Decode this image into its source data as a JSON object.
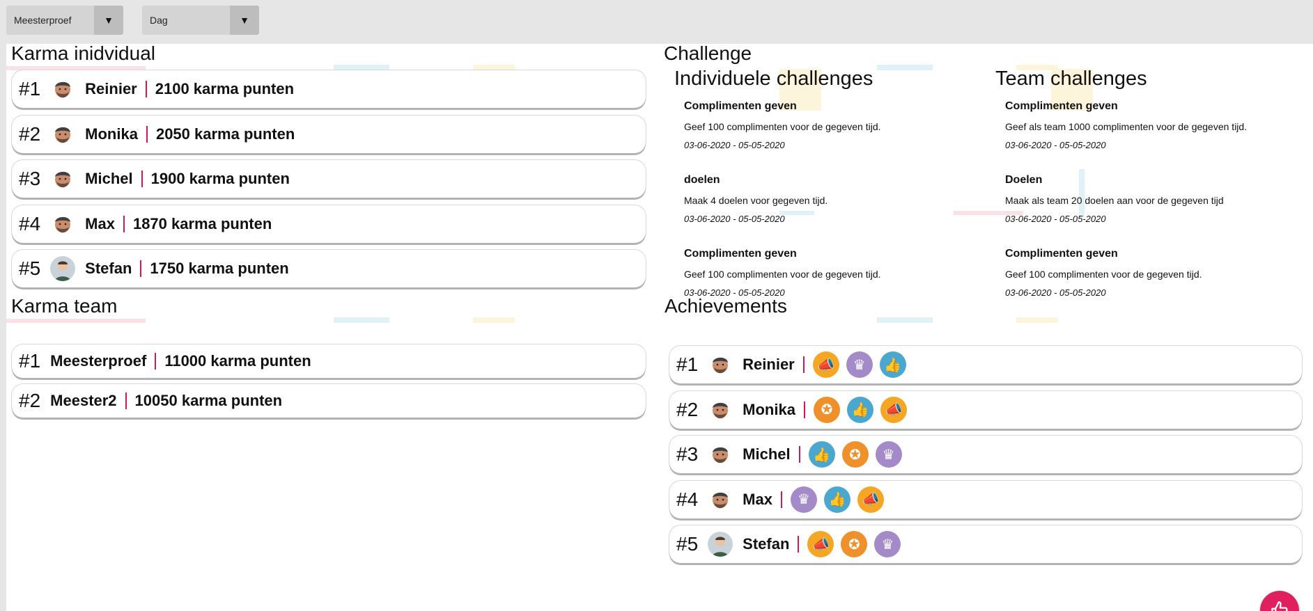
{
  "filters": {
    "team_select": "Meesterproef",
    "period_select": "Dag"
  },
  "karma_individual": {
    "title": "Karma inidvidual",
    "rows": [
      {
        "rank": "#1",
        "name": "Reinier",
        "points": "2100 karma punten",
        "avatar": "beard"
      },
      {
        "rank": "#2",
        "name": "Monika",
        "points": "2050 karma punten",
        "avatar": "beard"
      },
      {
        "rank": "#3",
        "name": "Michel",
        "points": "1900 karma punten",
        "avatar": "beard"
      },
      {
        "rank": "#4",
        "name": "Max",
        "points": "1870 karma punten",
        "avatar": "beard"
      },
      {
        "rank": "#5",
        "name": "Stefan",
        "points": "1750 karma punten",
        "avatar": "young"
      }
    ]
  },
  "karma_team": {
    "title": "Karma team",
    "rows": [
      {
        "rank": "#1",
        "name": "Meesterproef",
        "points": "11000 karma punten"
      },
      {
        "rank": "#2",
        "name": "Meester2",
        "points": "10050 karma punten"
      }
    ]
  },
  "challenge": {
    "title": "Challenge",
    "individual": {
      "title": "Individuele challenges",
      "items": [
        {
          "title": "Complimenten geven",
          "desc": "Geef 100 complimenten voor de gegeven tijd.",
          "date": "03-06-2020 - 05-05-2020"
        },
        {
          "title": "doelen",
          "desc": "Maak 4 doelen voor gegeven tijd.",
          "date": "03-06-2020 - 05-05-2020"
        },
        {
          "title": "Complimenten geven",
          "desc": "Geef 100 complimenten voor de gegeven tijd.",
          "date": "03-06-2020 - 05-05-2020"
        }
      ]
    },
    "team": {
      "title": "Team challenges",
      "items": [
        {
          "title": "Complimenten geven",
          "desc": "Geef als team 1000 complimenten voor de gegeven tijd.",
          "date": "03-06-2020 - 05-05-2020"
        },
        {
          "title": "Doelen",
          "desc": "Maak als team 20 doelen aan voor de gegeven tijd",
          "date": "03-06-2020 - 05-05-2020"
        },
        {
          "title": "Complimenten geven",
          "desc": "Geef 100 complimenten voor de gegeven tijd.",
          "date": "03-06-2020 - 05-05-2020"
        }
      ]
    }
  },
  "achievements": {
    "title": "Achievements",
    "rows": [
      {
        "rank": "#1",
        "name": "Reinier",
        "avatar": "beard",
        "badges": [
          "megaphone",
          "crown",
          "thumbs-up"
        ]
      },
      {
        "rank": "#2",
        "name": "Monika",
        "avatar": "beard",
        "badges": [
          "medal",
          "thumbs-up",
          "megaphone"
        ]
      },
      {
        "rank": "#3",
        "name": "Michel",
        "avatar": "beard",
        "badges": [
          "thumbs-up",
          "medal",
          "crown"
        ]
      },
      {
        "rank": "#4",
        "name": "Max",
        "avatar": "beard",
        "badges": [
          "crown",
          "thumbs-up",
          "megaphone"
        ]
      },
      {
        "rank": "#5",
        "name": "Stefan",
        "avatar": "young",
        "badges": [
          "megaphone",
          "medal",
          "crown"
        ]
      }
    ]
  },
  "colors": {
    "accent": "#d0195b",
    "fab": "#e0205e",
    "badge_megaphone": "#f5a623",
    "badge_crown": "#a58ac9",
    "badge_thumbs": "#4aa8d0",
    "badge_medal": "#f0902a"
  },
  "fab_icon": "thumbs-up-icon"
}
